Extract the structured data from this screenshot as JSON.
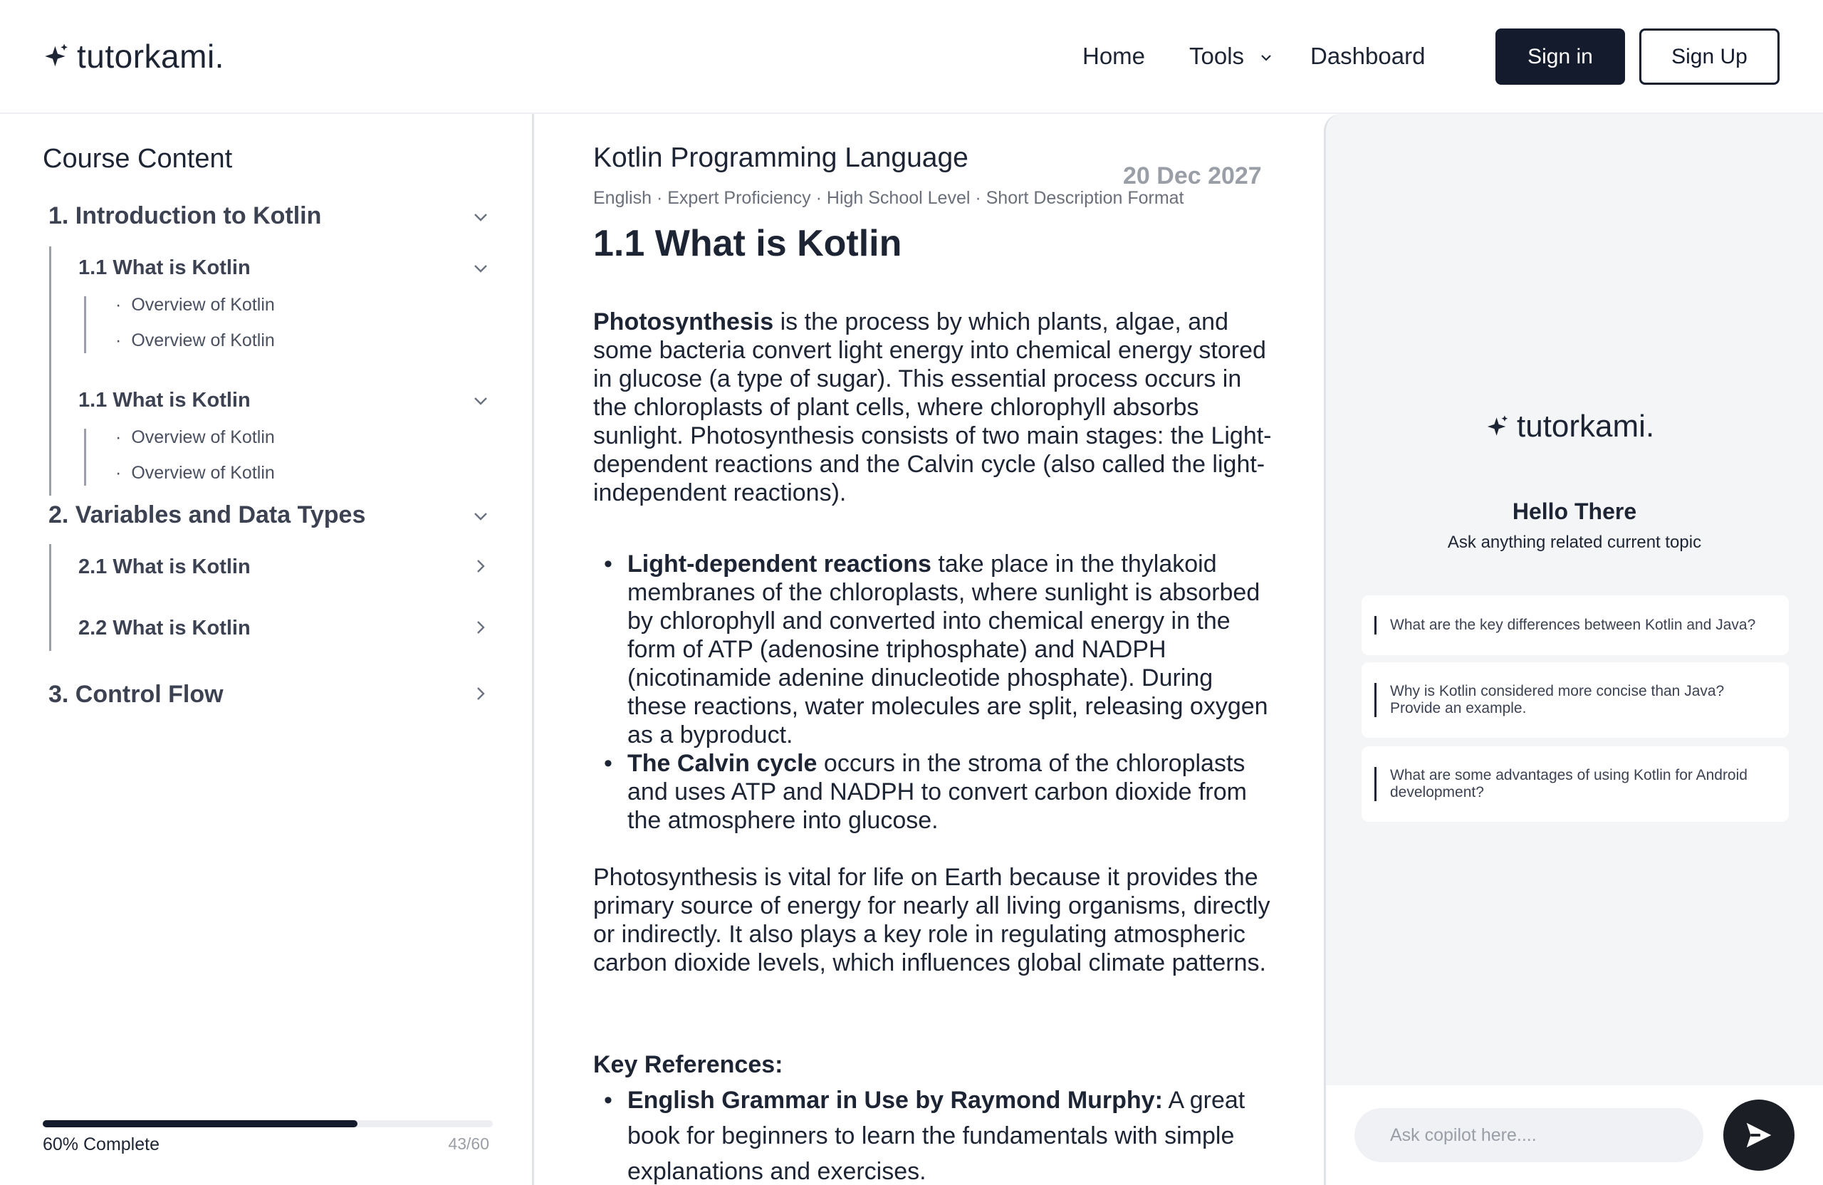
{
  "header": {
    "logo_text": "tutorkami.",
    "nav": [
      {
        "label": "Home"
      },
      {
        "label": "Tools"
      },
      {
        "label": "Dashboard"
      }
    ],
    "signin_label": "Sign in",
    "signup_label": "Sign Up"
  },
  "sidebar": {
    "title": "Course Content",
    "sections": [
      {
        "title": "1. Introduction to Kotlin",
        "expanded": true,
        "subsections": [
          {
            "title": "1.1 What is Kotlin",
            "expanded": true,
            "items": [
              "Overview of Kotlin",
              "Overview of Kotlin"
            ]
          },
          {
            "title": "1.1 What is Kotlin",
            "expanded": true,
            "items": [
              "Overview of Kotlin",
              "Overview of Kotlin"
            ]
          }
        ]
      },
      {
        "title": "2. Variables and Data Types",
        "expanded": true,
        "subsections": [
          {
            "title": "2.1 What is Kotlin",
            "expanded": false
          },
          {
            "title": "2.2 What is Kotlin",
            "expanded": false
          }
        ]
      },
      {
        "title": "3. Control Flow",
        "expanded": false
      }
    ],
    "progress": {
      "label": "60% Complete",
      "fraction": 0.7,
      "count": "43/60"
    }
  },
  "main": {
    "course_title": "Kotlin Programming Language",
    "date": "20 Dec 2027",
    "meta": "English · Expert Proficiency ·  High School Level · Short Description Format",
    "lesson_title": "1.1 What is Kotlin",
    "intro_bold": "Photosynthesis",
    "intro_rest": " is the process by which plants, algae, and some bacteria convert light energy into chemical energy stored in glucose (a type of sugar). This essential process occurs in the chloroplasts of plant cells, where chlorophyll absorbs sunlight. Photosynthesis consists of two main stages: the Light-dependent reactions and the Calvin cycle (also called the light-independent reactions).",
    "bullets": [
      {
        "bold": "Light-dependent reactions",
        "text": " take place in the thylakoid membranes of the chloroplasts, where sunlight is absorbed by chlorophyll and converted into chemical energy in the form of ATP (adenosine triphosphate) and NADPH (nicotinamide adenine dinucleotide phosphate). During these reactions, water molecules are split, releasing oxygen as a byproduct."
      },
      {
        "bold": "The Calvin cycle",
        "text": " occurs in the stroma of the chloroplasts and uses ATP and NADPH to convert carbon dioxide from the atmosphere into glucose."
      }
    ],
    "closing": "Photosynthesis is vital for life on Earth because it provides the primary source of energy for nearly all living organisms, directly or indirectly. It also plays a key role in regulating atmospheric carbon dioxide levels, which influences global climate patterns.",
    "refs_title": "Key References:",
    "refs": [
      {
        "bold": "English Grammar in Use by Raymond Murphy:",
        "text": " A great book for beginners to learn the fundamentals with simple explanations and exercises."
      }
    ]
  },
  "copilot": {
    "logo_text": "tutorkami.",
    "greeting": "Hello There",
    "subtitle": "Ask anything related current topic",
    "suggestions": [
      "What are the key differences between Kotlin and Java?",
      "Why is Kotlin considered more concise than Java? Provide an example.",
      "What are some advantages of using Kotlin for Android development?"
    ],
    "input_placeholder": "Ask copilot here...."
  }
}
